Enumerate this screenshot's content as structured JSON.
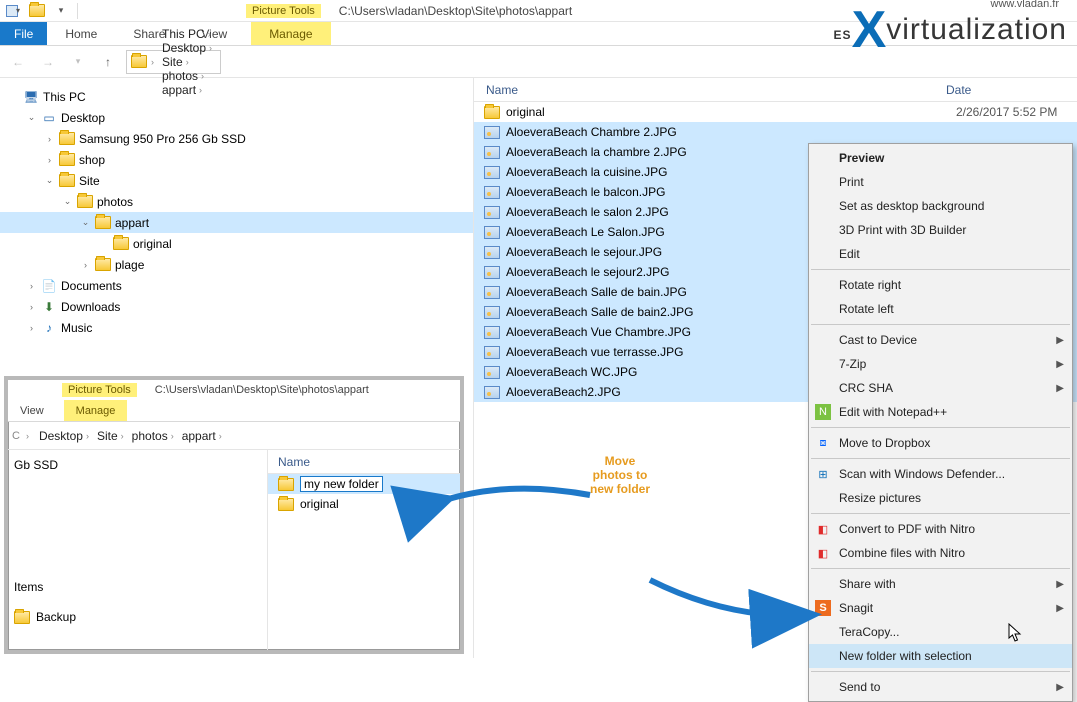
{
  "titlebar": {
    "contextTab": "Picture Tools",
    "path": "C:\\Users\\vladan\\Desktop\\Site\\photos\\appart"
  },
  "ribbon": {
    "file": "File",
    "home": "Home",
    "share": "Share",
    "view": "View",
    "manage": "Manage"
  },
  "crumbs": [
    "This PC",
    "Desktop",
    "Site",
    "photos",
    "appart"
  ],
  "tree": {
    "root": "This PC",
    "items": [
      {
        "label": "Desktop",
        "indent": 1,
        "exp": "v",
        "icon": "desktop"
      },
      {
        "label": "Samsung 950 Pro 256 Gb SSD",
        "indent": 2,
        "exp": ">",
        "icon": "folder"
      },
      {
        "label": "shop",
        "indent": 2,
        "exp": ">",
        "icon": "folder"
      },
      {
        "label": "Site",
        "indent": 2,
        "exp": "v",
        "icon": "folder"
      },
      {
        "label": "photos",
        "indent": 3,
        "exp": "v",
        "icon": "folder"
      },
      {
        "label": "appart",
        "indent": 4,
        "exp": "v",
        "icon": "folder",
        "sel": true
      },
      {
        "label": "original",
        "indent": 5,
        "exp": "",
        "icon": "folder"
      },
      {
        "label": "plage",
        "indent": 4,
        "exp": ">",
        "icon": "folder"
      },
      {
        "label": "Documents",
        "indent": 1,
        "exp": ">",
        "icon": "doc"
      },
      {
        "label": "Downloads",
        "indent": 1,
        "exp": ">",
        "icon": "dl"
      },
      {
        "label": "Music",
        "indent": 1,
        "exp": ">",
        "icon": "music"
      }
    ]
  },
  "columns": {
    "name": "Name",
    "date": "Date"
  },
  "folderRow": {
    "name": "original",
    "date": "2/26/2017 5:52 PM"
  },
  "files": [
    "AloeveraBeach Chambre 2.JPG",
    "AloeveraBeach la chambre 2.JPG",
    "AloeveraBeach la cuisine.JPG",
    "AloeveraBeach le balcon.JPG",
    "AloeveraBeach le salon 2.JPG",
    "AloeveraBeach Le Salon.JPG",
    "AloeveraBeach le sejour.JPG",
    "AloeveraBeach le sejour2.JPG",
    "AloeveraBeach Salle de bain.JPG",
    "AloeveraBeach Salle de bain2.JPG",
    "AloeveraBeach Vue Chambre.JPG",
    "AloeveraBeach vue terrasse.JPG",
    "AloeveraBeach WC.JPG",
    "AloeveraBeach2.JPG"
  ],
  "ctx": [
    {
      "label": "Preview",
      "bold": true
    },
    {
      "label": "Print"
    },
    {
      "label": "Set as desktop background"
    },
    {
      "label": "3D Print with 3D Builder"
    },
    {
      "label": "Edit"
    },
    {
      "sep": true
    },
    {
      "label": "Rotate right"
    },
    {
      "label": "Rotate left"
    },
    {
      "sep": true
    },
    {
      "label": "Cast to Device",
      "sub": true
    },
    {
      "label": "7-Zip",
      "sub": true
    },
    {
      "label": "CRC SHA",
      "sub": true
    },
    {
      "label": "Edit with Notepad++",
      "icon": "npp"
    },
    {
      "sep": true
    },
    {
      "label": "Move to Dropbox",
      "icon": "dbx"
    },
    {
      "sep": true
    },
    {
      "label": "Scan with Windows Defender...",
      "icon": "def"
    },
    {
      "label": "Resize pictures"
    },
    {
      "sep": true
    },
    {
      "label": "Convert to PDF with Nitro",
      "icon": "nitro"
    },
    {
      "label": "Combine files with Nitro",
      "icon": "nitro"
    },
    {
      "sep": true
    },
    {
      "label": "Share with",
      "sub": true
    },
    {
      "label": "Snagit",
      "sub": true,
      "icon": "snag"
    },
    {
      "label": "TeraCopy..."
    },
    {
      "label": "New folder with selection",
      "hover": true
    },
    {
      "sep": true
    },
    {
      "label": "Send to",
      "sub": true
    }
  ],
  "inset": {
    "contextTab": "Picture Tools",
    "path": "C:\\Users\\vladan\\Desktop\\Site\\photos\\appart",
    "view": "View",
    "manage": "Manage",
    "crumbs": [
      "Desktop",
      "Site",
      "photos",
      "appart"
    ],
    "treeA": "Gb SSD",
    "treeB": "Items",
    "treeC": "Backup",
    "colName": "Name",
    "newFolder": "my new folder",
    "original": "original"
  },
  "anno": {
    "l1": "Move",
    "l2": "photos to",
    "l3": "new folder"
  },
  "wm": {
    "a": "ES",
    "b": "virtualization",
    "url": "www.vladan.fr"
  }
}
